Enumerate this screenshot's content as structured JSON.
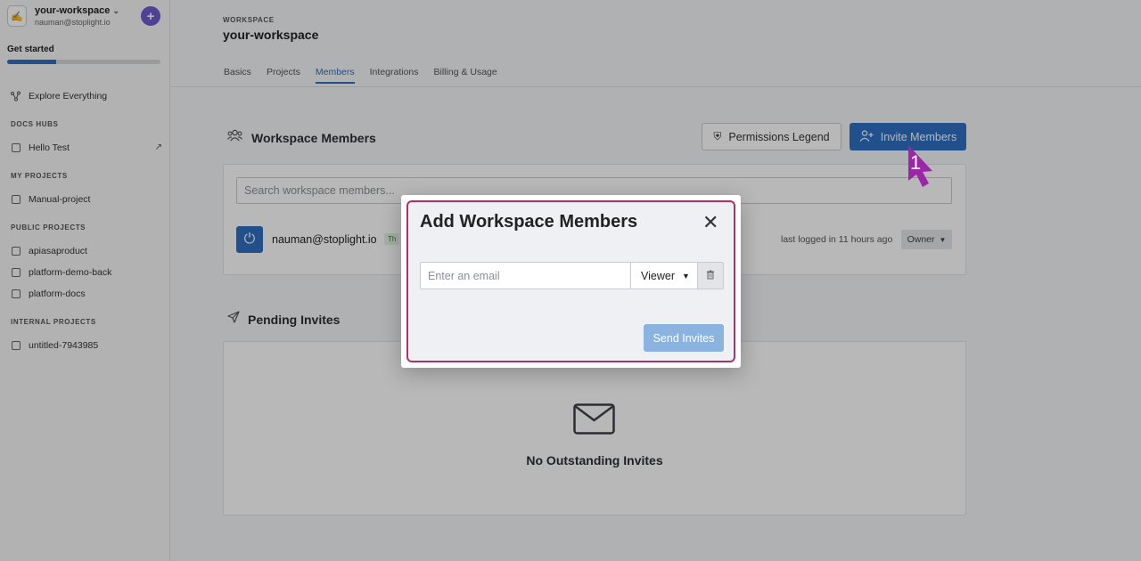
{
  "sidebar": {
    "workspace_name": "your-workspace",
    "workspace_email": "nauman@stoplight.io",
    "get_started_label": "Get started",
    "progress_fraction": 0.32,
    "explore_label": "Explore Everything",
    "docs_hubs_title": "DOCS HUBS",
    "docs_hubs": [
      {
        "label": "Hello Test"
      }
    ],
    "my_projects_title": "MY PROJECTS",
    "my_projects": [
      {
        "label": "Manual-project"
      }
    ],
    "public_projects_title": "PUBLIC PROJECTS",
    "public_projects": [
      {
        "label": "apiasaproduct"
      },
      {
        "label": "platform-demo-back"
      },
      {
        "label": "platform-docs"
      }
    ],
    "internal_projects_title": "INTERNAL PROJECTS",
    "internal_projects": [
      {
        "label": "untitled-7943985"
      }
    ]
  },
  "header": {
    "crumb": "WORKSPACE",
    "title": "your-workspace",
    "tabs": [
      {
        "label": "Basics"
      },
      {
        "label": "Projects"
      },
      {
        "label": "Members",
        "active": true
      },
      {
        "label": "Integrations"
      },
      {
        "label": "Billing & Usage"
      }
    ]
  },
  "members": {
    "title": "Workspace Members",
    "permissions_legend_label": "Permissions Legend",
    "invite_label": "Invite Members",
    "search_placeholder": "Search workspace members...",
    "rows": [
      {
        "email": "nauman@stoplight.io",
        "badge": "Th",
        "last_login": "last logged in 11 hours ago",
        "role": "Owner"
      }
    ]
  },
  "pending": {
    "title": "Pending Invites",
    "empty_text": "No Outstanding Invites"
  },
  "modal": {
    "title": "Add Workspace Members",
    "email_placeholder": "Enter an email",
    "role_value": "Viewer",
    "send_label": "Send Invites"
  },
  "annotation": {
    "step": "1"
  },
  "colors": {
    "accent": "#2f6fc2",
    "annotation": "#b0306b",
    "purple_button": "#6d5bd0"
  }
}
